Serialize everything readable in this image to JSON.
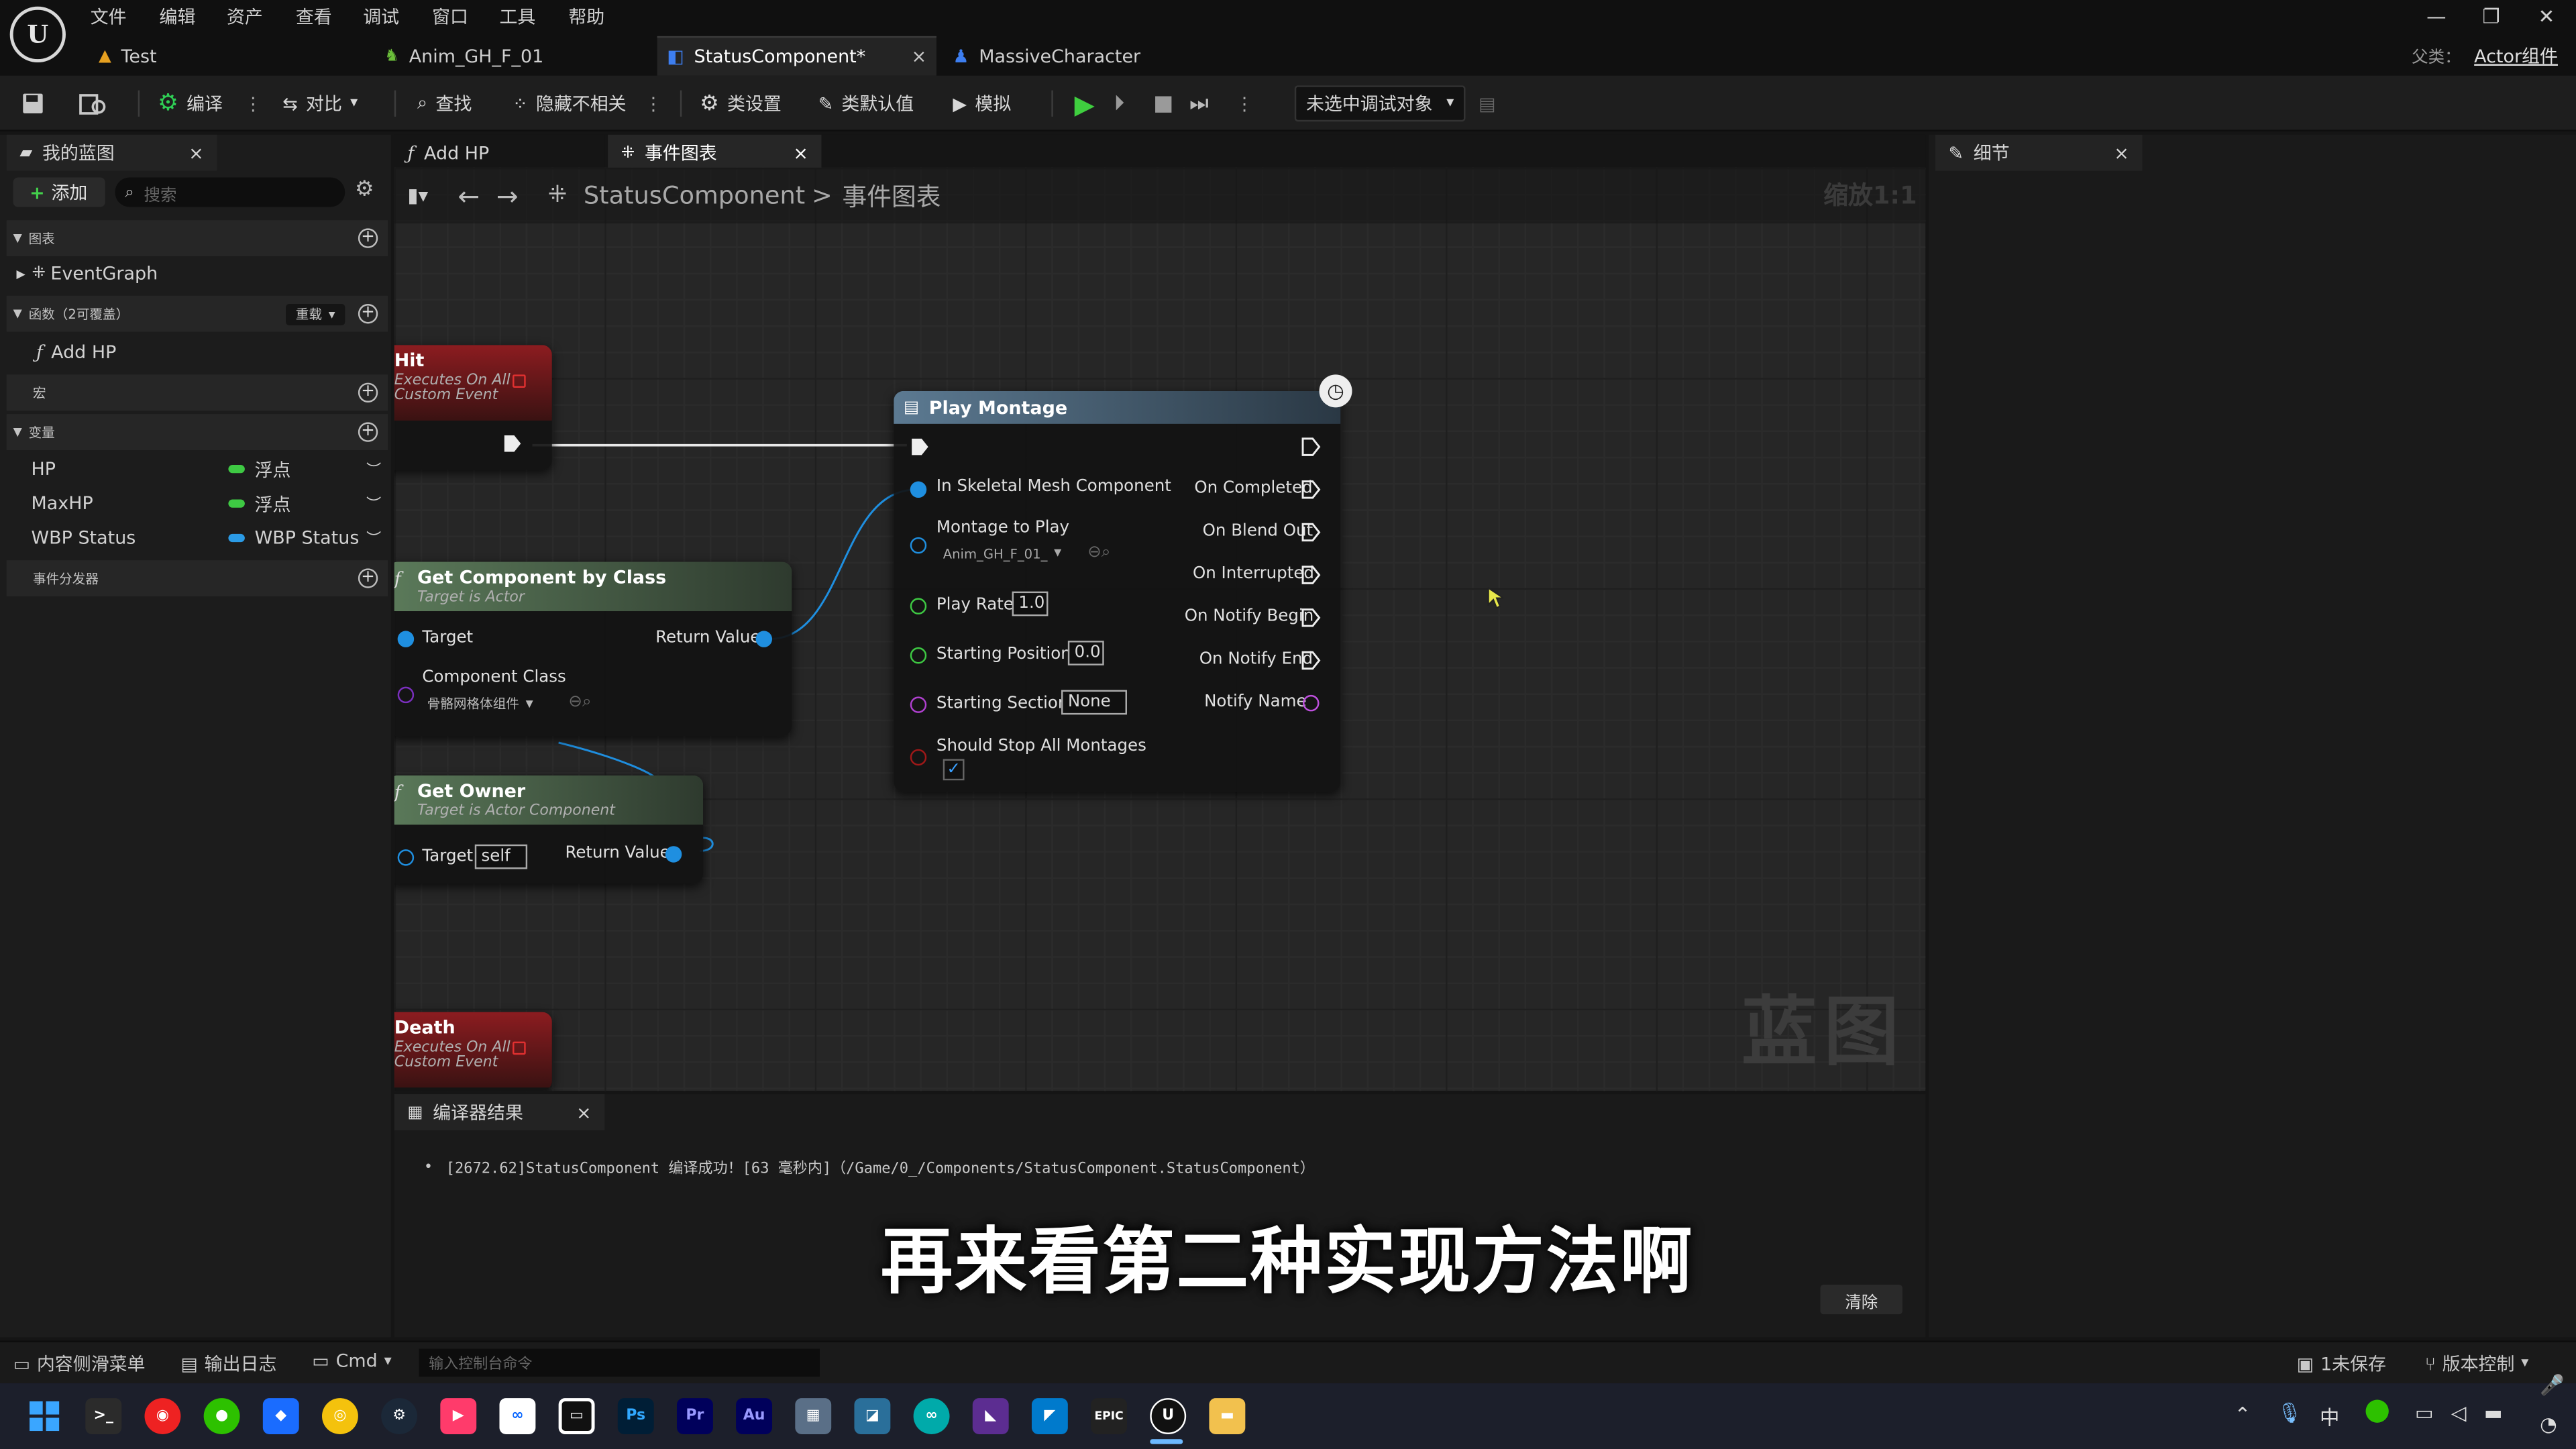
{
  "menubar": {
    "items": [
      "文件",
      "编辑",
      "资产",
      "查看",
      "调试",
      "窗口",
      "工具",
      "帮助"
    ],
    "doc_tabs": [
      "Test",
      "Anim_GH_F_01",
      "StatusComponent*",
      "MassiveCharacter"
    ],
    "parent_label": "父类：",
    "parent_value": "Actor组件"
  },
  "toolbar": {
    "compile": "编译",
    "diff": "对比",
    "find": "查找",
    "hide_unrelated": "隐藏不相关",
    "class_settings": "类设置",
    "class_defaults": "类默认值",
    "simulate": "模拟",
    "debug_object": "未选中调试对象"
  },
  "my_blueprint": {
    "tab_title": "我的蓝图",
    "add_button": "添加",
    "search_placeholder": "搜索",
    "sections": {
      "graphs": "图表",
      "functions": "函数（2可覆盖）",
      "override": "重载",
      "macros": "宏",
      "variables": "变量",
      "dispatchers": "事件分发器"
    },
    "graph_items": [
      "EventGraph"
    ],
    "function_items": [
      "Add HP"
    ],
    "variables": [
      {
        "name": "HP",
        "type": "浮点",
        "color": "#3ec943"
      },
      {
        "name": "MaxHP",
        "type": "浮点",
        "color": "#3ec943"
      },
      {
        "name": "WBP Status",
        "type": "WBP Status",
        "color": "#2b9be6"
      }
    ]
  },
  "editor_tabs": {
    "tab1": "Add HP",
    "tab2": "事件图表"
  },
  "graph": {
    "breadcrumb_root": "StatusComponent",
    "breadcrumb_sep": ">",
    "breadcrumb_leaf": "事件图表",
    "zoom": "缩放1:1",
    "watermark": "蓝图",
    "nodes": {
      "hit": {
        "title": "Hit",
        "subtitle": "Executes On All",
        "subtitle2": "Custom Event"
      },
      "death": {
        "title": "Death",
        "subtitle": "Executes On All",
        "subtitle2": "Custom Event"
      },
      "get_component": {
        "title": "Get Component by Class",
        "subtitle": "Target is Actor",
        "target": "Target",
        "return": "Return Value",
        "class_label": "Component Class",
        "class_value": "骨骼网格体组件"
      },
      "get_owner": {
        "title": "Get Owner",
        "subtitle": "Target is Actor Component",
        "target": "Target",
        "self": "self",
        "return": "Return Value"
      },
      "play_montage": {
        "title": "Play Montage",
        "in_mesh": "In Skeletal Mesh Component",
        "montage_label": "Montage to Play",
        "montage_value": "Anim_GH_F_01_",
        "play_rate": "Play Rate",
        "play_rate_value": "1.0",
        "start_pos": "Starting Position",
        "start_pos_value": "0.0",
        "start_section": "Starting Section",
        "start_section_value": "None",
        "stop_all": "Should Stop All Montages",
        "out_completed": "On Completed",
        "out_blend": "On Blend Out",
        "out_interrupted": "On Interrupted",
        "out_notify_begin": "On Notify Begin",
        "out_notify_end": "On Notify End",
        "out_notify_name": "Notify Name"
      }
    }
  },
  "details": {
    "tab_title": "细节"
  },
  "compiler": {
    "tab_title": "编译器结果",
    "message": "[2672.62]StatusComponent 编译成功！[63 毫秒内]（/Game/0_/Components/StatusComponent.StatusComponent）",
    "clear": "清除"
  },
  "subtitle": "再来看第二种实现方法啊",
  "bottombar": {
    "content_drawer": "内容侧滑菜单",
    "output_log": "输出日志",
    "cmd": "Cmd",
    "console_placeholder": "输入控制台命令",
    "unsaved": "1未保存",
    "source_control": "版本控制"
  },
  "taskbar": {
    "ime": "中"
  }
}
